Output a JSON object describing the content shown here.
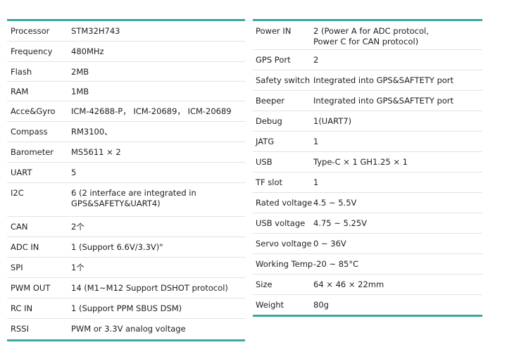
{
  "left_table": [
    {
      "label": "Processor",
      "value": "STM32H743"
    },
    {
      "label": "Frequency",
      "value": "480MHz"
    },
    {
      "label": "Flash",
      "value": "2MB"
    },
    {
      "label": "RAM",
      "value": "1MB"
    },
    {
      "label": "Acce&Gyro",
      "value": "ICM-42688-P， ICM-20689， ICM-20689"
    },
    {
      "label": "Compass",
      "value": "RM3100、"
    },
    {
      "label": "Barometer",
      "value": "MS5611 × 2"
    },
    {
      "label": "UART",
      "value": "5"
    },
    {
      "label": "I2C",
      "value": "6 (2 interface are integrated in\nGPS&SAFETY&UART4)"
    },
    {
      "label": "CAN",
      "value": "2个"
    },
    {
      "label": "ADC IN",
      "value": "1 (Support 6.6V/3.3V)\""
    },
    {
      "label": "SPI",
      "value": "1个"
    },
    {
      "label": "PWM OUT",
      "value": "14 (M1~M12 Support DSHOT protocol)"
    },
    {
      "label": "RC IN",
      "value": "1 (Support PPM SBUS DSM)"
    },
    {
      "label": "RSSI",
      "value": "PWM or 3.3V analog voltage"
    }
  ],
  "right_table": [
    {
      "label": "Power IN",
      "value": "2 (Power A for ADC protocol,\nPower C for CAN protocol)"
    },
    {
      "label": "GPS Port",
      "value": "2"
    },
    {
      "label": "Safety switch",
      "value": "Integrated into GPS&SAFTETY port"
    },
    {
      "label": "Beeper",
      "value": "Integrated into GPS&SAFTETY port"
    },
    {
      "label": "Debug",
      "value": "1(UART7)"
    },
    {
      "label": "JATG",
      "value": "1"
    },
    {
      "label": "USB",
      "value": "Type-C × 1 GH1.25 × 1"
    },
    {
      "label": "TF slot",
      "value": "1"
    },
    {
      "label": "Rated voltage",
      "value": "4.5 ~ 5.5V"
    },
    {
      "label": "USB voltage",
      "value": "4.75 ~ 5.25V"
    },
    {
      "label": "Servo voltage",
      "value": "0 ~ 36V"
    },
    {
      "label": "Working Temp",
      "value": "-20 ~ 85°C"
    },
    {
      "label": "Size",
      "value": "64 × 46 × 22mm"
    },
    {
      "label": "Weight",
      "value": "80g"
    }
  ],
  "accent_color": "#3aa8a0"
}
